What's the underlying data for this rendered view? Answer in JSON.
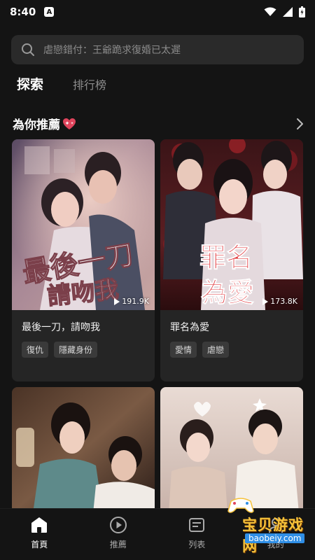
{
  "status_bar": {
    "time": "8:40",
    "notification_badge": "A"
  },
  "search": {
    "placeholder": "虐戀錯付：王爺跪求復婚已太遲"
  },
  "tabs": [
    {
      "label": "探索",
      "active": true
    },
    {
      "label": "排行榜",
      "active": false
    }
  ],
  "section": {
    "title": "為你推薦"
  },
  "cards": [
    {
      "title": "最後一刀，請吻我",
      "views": "191.9K",
      "poster_text": "最後一刀 請吻我",
      "tags": [
        "復仇",
        "隱藏身份"
      ]
    },
    {
      "title": "罪名為愛",
      "views": "173.8K",
      "poster_text": "罪名 為愛",
      "tags": [
        "愛情",
        "虐戀"
      ]
    },
    {
      "title": "",
      "views": "",
      "poster_text": "",
      "tags": []
    },
    {
      "title": "",
      "views": "",
      "poster_text": "",
      "tags": []
    }
  ],
  "bottom_nav": [
    {
      "label": "首頁",
      "icon": "home-icon",
      "active": true
    },
    {
      "label": "推薦",
      "icon": "play-circle-icon",
      "active": false
    },
    {
      "label": "列表",
      "icon": "list-icon",
      "active": false
    },
    {
      "label": "我的",
      "icon": "profile-icon",
      "active": false
    }
  ],
  "watermark": {
    "text": "宝贝游戏网",
    "url": "baobeiy.com"
  },
  "colors": {
    "background": "#141414",
    "card": "#252525",
    "search_bg": "#2a2a2a",
    "tag_bg": "#3a3a3a",
    "accent": "#e0445c"
  }
}
